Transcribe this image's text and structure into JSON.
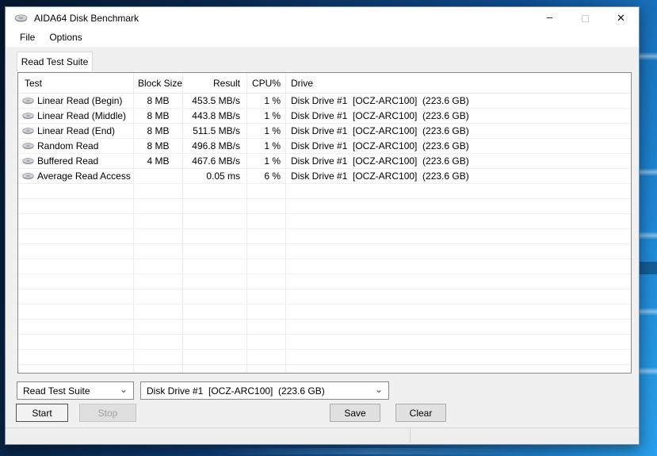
{
  "window": {
    "title": "AIDA64 Disk Benchmark",
    "controls": {
      "minimize_glyph": "–",
      "close_glyph": "✕"
    }
  },
  "menu": {
    "items": [
      "File",
      "Options"
    ]
  },
  "tab": {
    "label": "Read Test Suite"
  },
  "table": {
    "columns": [
      "Test",
      "Block Size",
      "Result",
      "CPU%",
      "Drive"
    ],
    "rows": [
      {
        "test": "Linear Read (Begin)",
        "block_size": "8 MB",
        "result": "453.5 MB/s",
        "cpu": "1 %",
        "drive": "Disk Drive #1  [OCZ-ARC100]  (223.6 GB)"
      },
      {
        "test": "Linear Read (Middle)",
        "block_size": "8 MB",
        "result": "443.8 MB/s",
        "cpu": "1 %",
        "drive": "Disk Drive #1  [OCZ-ARC100]  (223.6 GB)"
      },
      {
        "test": "Linear Read (End)",
        "block_size": "8 MB",
        "result": "511.5 MB/s",
        "cpu": "1 %",
        "drive": "Disk Drive #1  [OCZ-ARC100]  (223.6 GB)"
      },
      {
        "test": "Random Read",
        "block_size": "8 MB",
        "result": "496.8 MB/s",
        "cpu": "1 %",
        "drive": "Disk Drive #1  [OCZ-ARC100]  (223.6 GB)"
      },
      {
        "test": "Buffered Read",
        "block_size": "4 MB",
        "result": "467.6 MB/s",
        "cpu": "1 %",
        "drive": "Disk Drive #1  [OCZ-ARC100]  (223.6 GB)"
      },
      {
        "test": "Average Read Access",
        "block_size": "",
        "result": "0.05 ms",
        "cpu": "6 %",
        "drive": "Disk Drive #1  [OCZ-ARC100]  (223.6 GB)"
      }
    ]
  },
  "controls": {
    "suite_select_value": "Read Test Suite",
    "drive_select_value": "Disk Drive #1  [OCZ-ARC100]  (223.6 GB)",
    "dropdown_glyph": "⌄",
    "start_label": "Start",
    "stop_label": "Stop",
    "save_label": "Save",
    "clear_label": "Clear"
  },
  "colors": {
    "desktop_dark": "#06182f",
    "desktop_bright": "#2aa0ec",
    "window_bg": "#f0f0f0",
    "titlebar_bg": "#ffffff",
    "table_border": "#888c92",
    "grid_line": "#ececec",
    "button_bg": "#e1e1e1",
    "disabled_text": "#9f9f9f"
  }
}
